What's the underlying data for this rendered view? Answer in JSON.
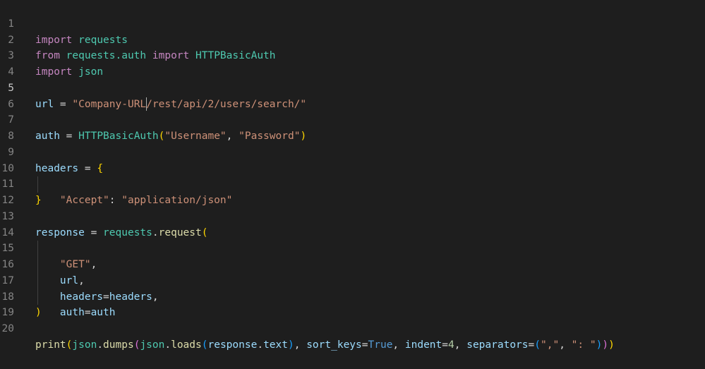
{
  "editor": {
    "line_numbers": [
      "1",
      "2",
      "3",
      "4",
      "5",
      "6",
      "7",
      "8",
      "9",
      "10",
      "11",
      "12",
      "13",
      "14",
      "15",
      "16",
      "17",
      "18",
      "19",
      "20"
    ],
    "active_line": 5,
    "code": {
      "l1": {
        "import": "import",
        "mod": "requests"
      },
      "l2": {
        "from": "from",
        "mod": "requests.auth",
        "import": "import",
        "cls": "HTTPBasicAuth"
      },
      "l3": {
        "import": "import",
        "mod": "json"
      },
      "l5": {
        "var": "url",
        "eq": " = ",
        "str_a": "\"Company-URL",
        "str_b": "/rest/api/2/users/search/\""
      },
      "l7": {
        "var": "auth",
        "eq": " = ",
        "cls": "HTTPBasicAuth",
        "open": "(",
        "s1": "\"Username\"",
        "comma": ", ",
        "s2": "\"Password\"",
        "close": ")"
      },
      "l9": {
        "var": "headers",
        "eq": " = ",
        "open": "{"
      },
      "l10": {
        "key": "\"Accept\"",
        "colon": ": ",
        "val": "\"application/json\""
      },
      "l11": {
        "close": "}"
      },
      "l13": {
        "var": "response",
        "eq": " = ",
        "obj": "requests",
        "dot": ".",
        "fn": "request",
        "open": "("
      },
      "l14": {
        "str": "\"GET\"",
        "comma": ","
      },
      "l15": {
        "var": "url",
        "comma": ","
      },
      "l16": {
        "key": "headers",
        "eq": "=",
        "val": "headers",
        "comma": ","
      },
      "l17": {
        "key": "auth",
        "eq": "=",
        "val": "auth"
      },
      "l18": {
        "close": ")"
      },
      "l20": {
        "print": "print",
        "p1": "(",
        "json1": "json",
        "dot1": ".",
        "dumps": "dumps",
        "p2": "(",
        "json2": "json",
        "dot2": ".",
        "loads": "loads",
        "p3": "(",
        "resp": "response",
        "dot3": ".",
        "text": "text",
        "p3c": ")",
        "c1": ", ",
        "sort_keys": "sort_keys",
        "eq1": "=",
        "true": "True",
        "c2": ", ",
        "indent": "indent",
        "eq2": "=",
        "four": "4",
        "c3": ", ",
        "separators": "separators",
        "eq3": "=",
        "p4": "(",
        "sep1": "\",\"",
        "c4": ", ",
        "sep2": "\": \"",
        "p4c": ")",
        "p2c": ")",
        "p1c": ")"
      }
    }
  }
}
